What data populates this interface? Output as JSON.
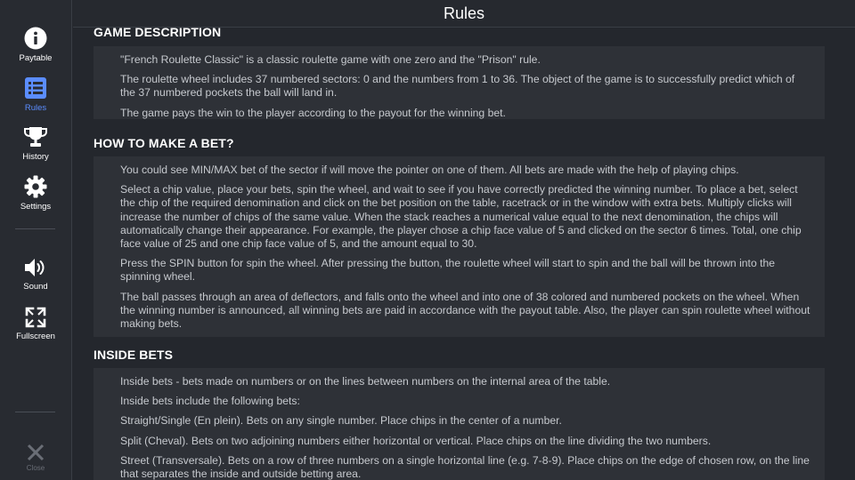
{
  "header": {
    "title": "Rules"
  },
  "sidebar": {
    "items": [
      {
        "label": "Paytable",
        "icon": "info-icon"
      },
      {
        "label": "Rules",
        "icon": "list-icon",
        "active": true
      },
      {
        "label": "History",
        "icon": "trophy-icon"
      },
      {
        "label": "Settings",
        "icon": "gear-icon"
      },
      {
        "label": "Sound",
        "icon": "speaker-icon"
      },
      {
        "label": "Fullscreen",
        "icon": "fullscreen-icon"
      }
    ],
    "close_label": "Close"
  },
  "sections": [
    {
      "title": "GAME DESCRIPTION",
      "paragraphs": [
        "\"French Roulette Classic\" is a classic roulette game with one zero and the \"Prison\" rule.",
        "The roulette wheel includes 37 numbered sectors: 0 and the numbers from 1 to 36. The object of the game is to successfully predict which of the 37 numbered pockets the ball will land in.",
        "The game pays the win to the player according to the payout for the winning bet."
      ]
    },
    {
      "title": "HOW TO MAKE A BET?",
      "paragraphs": [
        "You could see MIN/MAX bet of the sector if will move the pointer on one of them. All bets are made with the help of playing chips.",
        "Select a chip value, place your bets, spin the wheel, and wait to see if you have correctly predicted the winning number. To place a bet, select the chip of the required denomination and click on the bet position on the table, racetrack or in the window with extra bets. Multiply clicks will increase the number of chips of the same value. When the stack reaches a numerical value equal to the next denomination, the chips will automatically change their appearance. For example, the player chose a chip face value of 5 and clicked on the sector 6 times. Total, one chip face value of 25 and one chip face value of 5, and the amount equal to 30.",
        "Press the SPIN button for spin the wheel. After pressing the button, the roulette wheel will start to spin and the ball will be thrown into the spinning wheel.",
        "The ball passes through an area of deflectors, and falls onto the wheel and into one of 38 colored and numbered pockets on the wheel. When the winning number is announced, all winning bets are paid in accordance with the payout table. Also, the player can spin roulette wheel without making bets."
      ]
    },
    {
      "title": "INSIDE BETS",
      "paragraphs": [
        "Inside bets - bets made on numbers or on the lines between numbers on the internal area of the table.",
        "Inside bets include the following bets:",
        "Straight/Single (En plein). Bets on any single number. Place chips in the center of a number.",
        "Split (Cheval). Bets on two adjoining numbers either horizontal or vertical. Place chips on the line dividing the two numbers.",
        "Street (Transversale). Bets on a row of three numbers on a single horizontal line (e.g. 7-8-9). Place chips on the edge of chosen row, on the line that separates the inside and outside betting area."
      ]
    }
  ],
  "colors": {
    "active": "#5b8dff",
    "background": "#24272d",
    "panel": "#2e3137"
  }
}
